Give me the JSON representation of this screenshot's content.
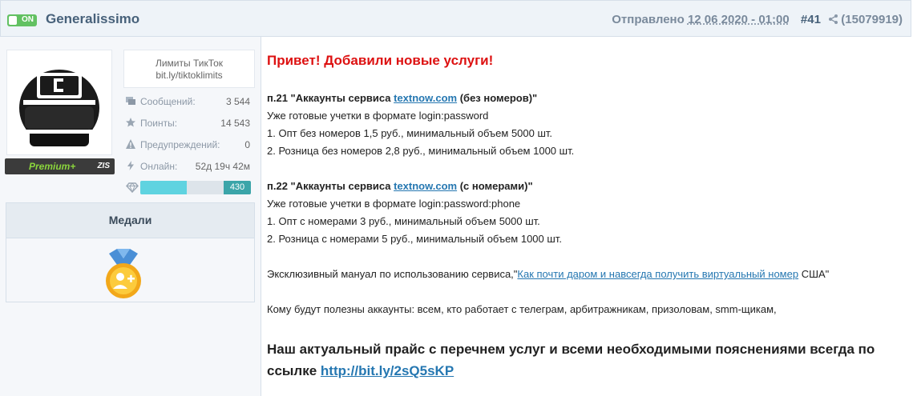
{
  "header": {
    "toggle_label": "ON",
    "username": "Generalissimo",
    "sent_label": "Отправлено",
    "date": "12 06 2020 - 01:00",
    "post_number": "#41",
    "share_count": "(15079919)"
  },
  "user": {
    "signature_line1": "Лимиты ТикТок",
    "signature_line2": "bit.ly/tiktoklimits",
    "rank_badge": "Premium+",
    "rank_tag": "ZIS",
    "stats": [
      {
        "icon": "messages-icon",
        "label": "Сообщений:",
        "value": "3 544"
      },
      {
        "icon": "star-icon",
        "label": "Поинты:",
        "value": "14 543"
      },
      {
        "icon": "warning-icon",
        "label": "Предупреждений:",
        "value": "0"
      },
      {
        "icon": "lightning-icon",
        "label": "Онлайн:",
        "value": "52д 19ч 42м"
      }
    ],
    "reputation": {
      "icon": "diamond-icon",
      "value": "430",
      "fill_fraction": 0.42
    },
    "medals_title": "Медали"
  },
  "post": {
    "greeting": "Привет! Добавили новые услуги!",
    "item21": {
      "title_prefix": "п.21 \"Аккаунты сервиса ",
      "link": "textnow.com",
      "title_suffix": " (без номеров)\"",
      "lines": [
        "Уже готовые учетки в формате login:password",
        "1. Опт без номеров 1,5 руб., минимальный объем 5000 шт.",
        "2. Розница без номеров 2,8 руб., минимальный объем 1000 шт."
      ]
    },
    "item22": {
      "title_prefix": "п.22 \"Аккаунты сервиса ",
      "link": "textnow.com",
      "title_suffix": " (с номерами)\"",
      "lines": [
        "Уже готовые учетки в формате login:password:phone",
        "1. Опт с номерами 3 руб., минимальный объем 5000 шт.",
        "2. Розница с номерами 5 руб., минимальный объем 1000 шт."
      ]
    },
    "manual_prefix": "Эксклюзивный мануал по использованию сервиса,\"",
    "manual_link": "Как почти даром и навсегда получить виртуальный номер",
    "manual_suffix": " США\"",
    "audience": "Кому будут полезны аккаунты: всем, кто работает с телеграм, арбитражникам, призоловам, smm-щикам,",
    "price_text": "Наш актуальный прайс с перечнем услуг и всеми необходимыми пояснениями всегда по ссылке ",
    "price_link": "http://bit.ly/2sQ5sKP"
  },
  "colors": {
    "accent_link": "#2577b1",
    "greeting_red": "#dd1111",
    "toggle_green": "#62c162",
    "premium_green": "#8bd63c"
  }
}
